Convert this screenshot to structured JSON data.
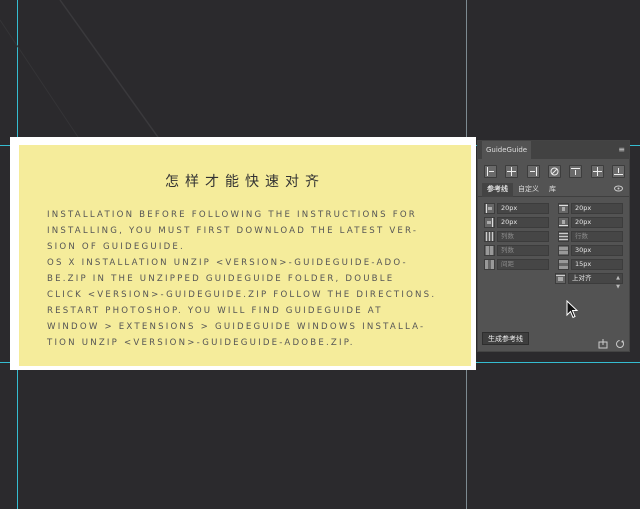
{
  "document": {
    "title": "怎样才能快速对齐",
    "body": "Installation Before following the instructions for installing, you must first download the latest ver-\nsion of GuideGuide.\nOS X Installation Unzip <version>-guideguide-ado-\nbe.zip In the unzipped GuideGuide folder, double\nclick <version>-guideguide.zip Follow the directions.\nRestart Photoshop. You will find GuideGuide at\nWindow > Extensions > GuideGuide Windows Installa-\ntion Unzip <version>-guideguide-adobe.zip."
  },
  "panel": {
    "tab_name": "GuideGuide",
    "tabs": [
      "参考线",
      "自定义",
      "库"
    ],
    "left_fields": [
      {
        "value": "20px",
        "placeholder": false
      },
      {
        "value": "20px",
        "placeholder": false
      },
      {
        "value": "列数",
        "placeholder": true
      },
      {
        "value": "列数",
        "placeholder": true
      },
      {
        "value": "间距",
        "placeholder": true
      }
    ],
    "right_fields": [
      {
        "value": "20px",
        "placeholder": false
      },
      {
        "value": "20px",
        "placeholder": false
      },
      {
        "value": "行数",
        "placeholder": true
      },
      {
        "value": "30px",
        "placeholder": false
      },
      {
        "value": "15px",
        "placeholder": false
      }
    ],
    "align_select": "上对齐",
    "generate_button": "生成参考线"
  },
  "colors": {
    "canvas_bg": "#2b2a2d",
    "document_fill": "#f5ec9b",
    "guide": "#3fc6d8",
    "panel_bg": "#535353"
  }
}
